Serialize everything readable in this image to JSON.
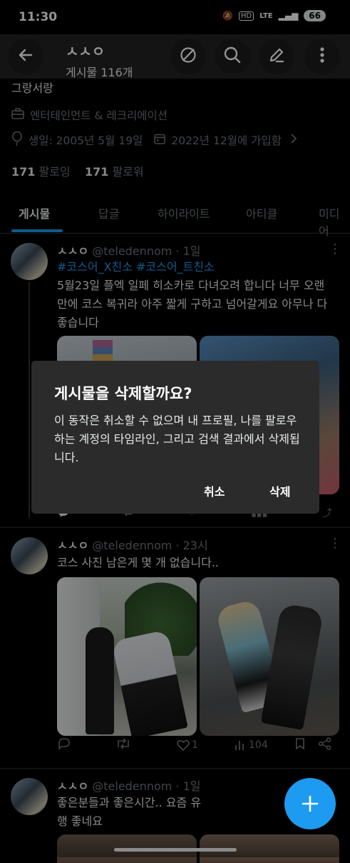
{
  "status_bar": {
    "time": "11:30",
    "icons_text": "LTE",
    "battery": "66"
  },
  "header": {
    "name": "ㅅㅅㅇ",
    "post_count": "게시물 116개"
  },
  "profile": {
    "bio_fragment": "그랑서랑",
    "category": "엔터테인먼트 & 레크리에이션",
    "birthday": "생일: 2005년 5월 19일",
    "joined": "2022년 12월에 가입함",
    "following_count": "171",
    "following_label": "팔로잉",
    "followers_count": "171",
    "followers_label": "팔로워"
  },
  "tabs": [
    {
      "label": "게시물"
    },
    {
      "label": "답글"
    },
    {
      "label": "하이라이트"
    },
    {
      "label": "아티클"
    },
    {
      "label": "미디어"
    }
  ],
  "tweets": [
    {
      "name": "ㅅㅅㅇ",
      "handle": "@teledennom",
      "time": "· 1일",
      "hashtags": "#코스어_X친소 #코스어_트친소",
      "text": "5월23일 플엑 일페 히소카로 다녀오려 합니다 너무 오랜만에 코스 복귀라 아주 짧게 구하고 넘어갈게요 아무나 다 좋습니다"
    },
    {
      "name": "ㅅㅅㅇ",
      "handle": "@teledennom",
      "time": "· 23시",
      "text": "코스 사진 남은게 몇 개 없습니다..",
      "likes": "1",
      "views": "104"
    },
    {
      "name": "ㅅㅅㅇ",
      "handle": "@teledennom",
      "time": "· 1일",
      "text": "좋은분들과 좋은시간.. 요즘 유행 좋네요"
    }
  ],
  "dialog": {
    "title": "게시물을 삭제할까요?",
    "body": "이 동작은 취소할 수 없으며 내 프로필, 나를 팔로우하는 계정의 타임라인, 그리고 검색 결과에서 삭제됩니다.",
    "cancel": "취소",
    "delete": "삭제"
  },
  "icons": [
    "back-arrow-icon",
    "block-icon",
    "search-icon",
    "edit-icon",
    "more-vertical-icon",
    "briefcase-icon",
    "balloon-icon",
    "calendar-icon",
    "chevron-right-icon",
    "reply-icon",
    "retweet-icon",
    "like-icon",
    "views-icon",
    "bookmark-icon",
    "share-icon",
    "plus-icon"
  ],
  "colors": {
    "accent": "#1d9bf0",
    "background": "#000000",
    "dialog": "#2b2b2b",
    "muted": "#71767b"
  }
}
